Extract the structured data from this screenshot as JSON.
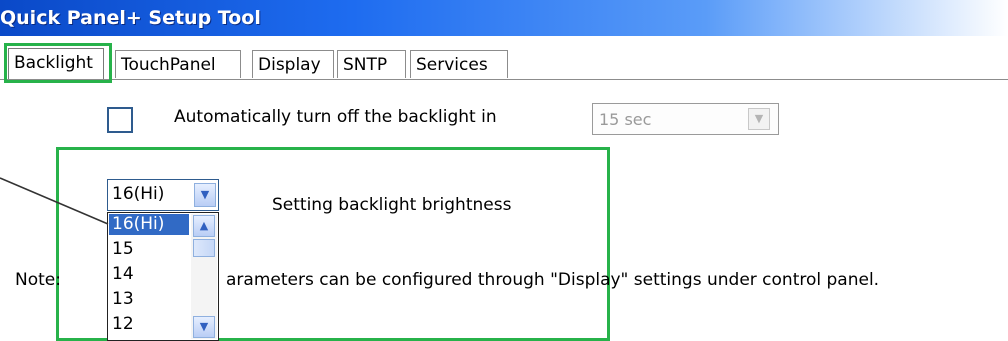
{
  "window": {
    "title": "Quick Panel+ Setup Tool"
  },
  "tabs": [
    {
      "label": "Backlight",
      "active": true
    },
    {
      "label": "TouchPanel",
      "active": false
    },
    {
      "label": "Display",
      "active": false
    },
    {
      "label": "SNTP",
      "active": false
    },
    {
      "label": "Services",
      "active": false
    }
  ],
  "auto_off": {
    "checked": false,
    "label": "Automatically turn off the backlight in",
    "timeout_value": "15 sec",
    "enabled": false
  },
  "brightness": {
    "label": "Setting backlight brightness",
    "selected": "16(Hi)",
    "dropdown_open": true,
    "visible_options": [
      "16(Hi)",
      "15",
      "14",
      "13",
      "12"
    ]
  },
  "note": {
    "visible_start": "Note: ",
    "visible_rest": "arameters can be configured through \"Display\" settings under control panel."
  },
  "colors": {
    "highlight": "#27b24a",
    "title_bar": "#1e6cf0",
    "selection": "#316ac5"
  },
  "icons": {
    "combo_button": "chevron-down-icon",
    "scroll_up": "chevron-up-icon",
    "scroll_down": "chevron-down-icon"
  }
}
